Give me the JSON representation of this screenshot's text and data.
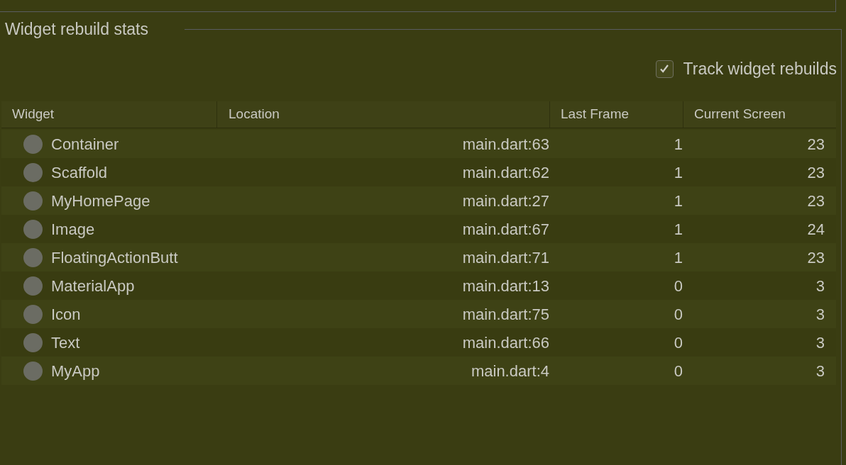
{
  "group": {
    "title": "Widget rebuild stats"
  },
  "track_rebuilds": {
    "label": "Track widget rebuilds",
    "checked": true
  },
  "table": {
    "columns": [
      "Widget",
      "Location",
      "Last Frame",
      "Current Screen"
    ],
    "rows": [
      {
        "widget": "Container",
        "location": "main.dart:63",
        "last_frame": "1",
        "current_screen": "23"
      },
      {
        "widget": "Scaffold",
        "location": "main.dart:62",
        "last_frame": "1",
        "current_screen": "23"
      },
      {
        "widget": "MyHomePage",
        "location": "main.dart:27",
        "last_frame": "1",
        "current_screen": "23"
      },
      {
        "widget": "Image",
        "location": "main.dart:67",
        "last_frame": "1",
        "current_screen": "24"
      },
      {
        "widget": "FloatingActionButt",
        "location": "main.dart:71",
        "last_frame": "1",
        "current_screen": "23"
      },
      {
        "widget": "MaterialApp",
        "location": "main.dart:13",
        "last_frame": "0",
        "current_screen": "3"
      },
      {
        "widget": "Icon",
        "location": "main.dart:75",
        "last_frame": "0",
        "current_screen": "3"
      },
      {
        "widget": "Text",
        "location": "main.dart:66",
        "last_frame": "0",
        "current_screen": "3"
      },
      {
        "widget": "MyApp",
        "location": "main.dart:4",
        "last_frame": "0",
        "current_screen": "3"
      }
    ]
  }
}
